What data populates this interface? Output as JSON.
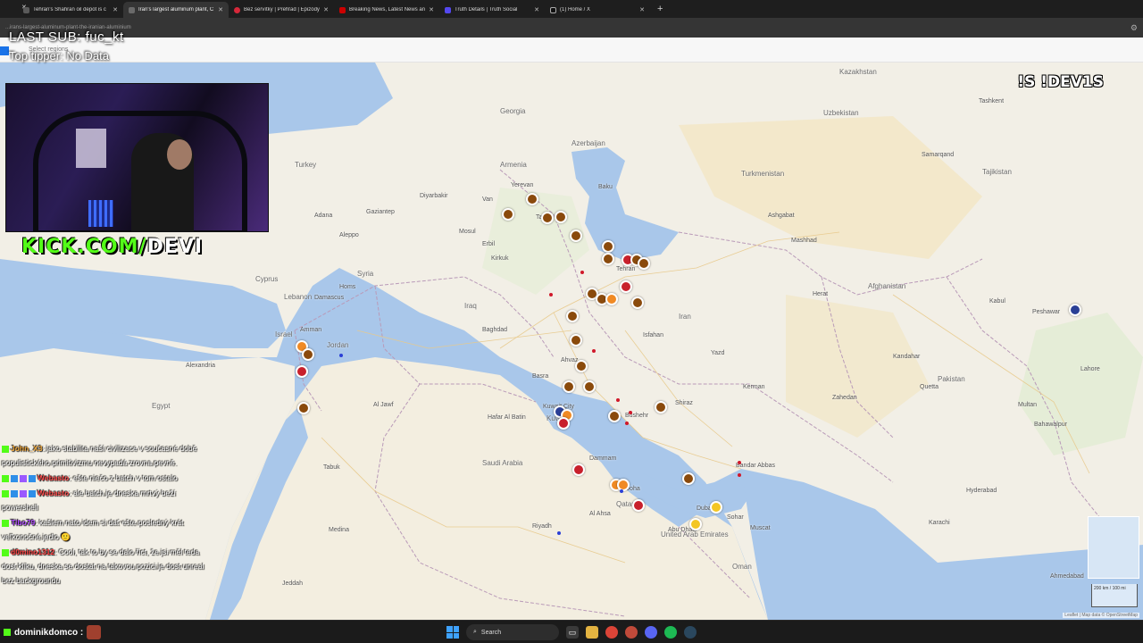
{
  "browser": {
    "tabs": [
      {
        "title": "Tehran's Shahran oil depot is c",
        "fav": "#5a5a5a",
        "active": false
      },
      {
        "title": "Iran's largest aluminum plant, C",
        "fav": "#6a6a6a",
        "active": true
      },
      {
        "title": "Bez servítky | Prehľad | Epizódy",
        "fav": "#d6283a",
        "active": false
      },
      {
        "title": "Breaking News, Latest News an",
        "fav": "#cc0000",
        "active": false
      },
      {
        "title": "Truth Details | Truth Social",
        "fav": "#5448ee",
        "active": false
      },
      {
        "title": "(1) Home / X",
        "fav": "#111111",
        "active": false
      }
    ],
    "new_tab": "+",
    "close": "✕",
    "url": "...irans-largest-aluminum-plant-the-iranian-aluminium",
    "settings_icon": "gear-icon"
  },
  "map_toolbar": {
    "select_regions": "Select regions"
  },
  "overlay": {
    "last_sub": "LAST SUB: fuc_kt",
    "top_tipper": "Top tipper: No Data",
    "kick_prefix": "KICK.COM/",
    "kick_suffix": "DEVI",
    "command": "!S !DEV1S"
  },
  "map": {
    "countries": [
      {
        "label": "Kazakhstan"
      },
      {
        "label": "Uzbekistan"
      },
      {
        "label": "Turkmenistan"
      },
      {
        "label": "Tajikistan"
      },
      {
        "label": "Afghanistan"
      },
      {
        "label": "Pakistan"
      },
      {
        "label": "Iran"
      },
      {
        "label": "Iraq"
      },
      {
        "label": "Syria"
      },
      {
        "label": "Jordan"
      },
      {
        "label": "Saudi Arabia"
      },
      {
        "label": "Egypt"
      },
      {
        "label": "Oman"
      },
      {
        "label": "United Arab Emirates"
      },
      {
        "label": "Kuwait"
      },
      {
        "label": "Qatar"
      },
      {
        "label": "Turkey"
      },
      {
        "label": "Azerbaijan"
      },
      {
        "label": "Georgia"
      },
      {
        "label": "Armenia"
      },
      {
        "label": "Cyprus"
      },
      {
        "label": "Lebanon"
      },
      {
        "label": "Israel"
      }
    ],
    "cities": [
      {
        "label": "Baghdad"
      },
      {
        "label": "Tehran"
      },
      {
        "label": "Riyadh"
      },
      {
        "label": "Kabul"
      },
      {
        "label": "Peshawar"
      },
      {
        "label": "Amman"
      },
      {
        "label": "Damascus"
      },
      {
        "label": "Homs"
      },
      {
        "label": "Aleppo"
      },
      {
        "label": "Mosul"
      },
      {
        "label": "Kirkuk"
      },
      {
        "label": "Basra"
      },
      {
        "label": "Kuwait City"
      },
      {
        "label": "Dammam"
      },
      {
        "label": "Doha"
      },
      {
        "label": "Dubai"
      },
      {
        "label": "Muscat"
      },
      {
        "label": "Bandar Abbas"
      },
      {
        "label": "Shiraz"
      },
      {
        "label": "Isfahan"
      },
      {
        "label": "Mashhad"
      },
      {
        "label": "Kandahar"
      },
      {
        "label": "Quetta"
      },
      {
        "label": "Herat"
      },
      {
        "label": "Samarqand"
      },
      {
        "label": "Tashkent"
      },
      {
        "label": "Ashgabat"
      },
      {
        "label": "Tabriz"
      },
      {
        "label": "Yerevan"
      },
      {
        "label": "Baku"
      },
      {
        "label": "Jeddah"
      },
      {
        "label": "Medina"
      },
      {
        "label": "Hyderabad"
      },
      {
        "label": "Karachi"
      },
      {
        "label": "Multan"
      },
      {
        "label": "Lahore"
      },
      {
        "label": "Ahmedabad"
      },
      {
        "label": "Bahawalpur"
      },
      {
        "label": "Zahedan"
      },
      {
        "label": "Kerman"
      },
      {
        "label": "Yazd"
      },
      {
        "label": "Al Ahsa"
      },
      {
        "label": "Hafar Al Batin"
      },
      {
        "label": "Al Jawf"
      },
      {
        "label": "Tabuk"
      },
      {
        "label": "Alexandria"
      },
      {
        "label": "Gaziantep"
      },
      {
        "label": "Adana"
      },
      {
        "label": "Diyarbakir"
      },
      {
        "label": "Van"
      },
      {
        "label": "Erbil"
      },
      {
        "label": "Ahvaz"
      },
      {
        "label": "Bushehr"
      },
      {
        "label": "Abu Dhabi"
      },
      {
        "label": "Sohar"
      }
    ],
    "attribution": "Leaflet | Map data © OpenStreetMap",
    "scale": "200 km / 100 mi"
  },
  "chat": [
    {
      "user": "John_X3",
      "color": "#f2a93b",
      "badges": 1,
      "text": ": jako stabilita naší civilizace v současné době populistického primitivizmu nevypadá zrovna pevně."
    },
    {
      "user": "Webasto",
      "color": "#ff4b4b",
      "badges": 4,
      "text": ": ešte niečo z batch v tom ostalo"
    },
    {
      "user": "Webasto",
      "color": "#ff4b4b",
      "badges": 4,
      "text": ": ale batch je dneska mrtvý beží powershell"
    },
    {
      "user": "Tibo79",
      "color": "#b04bff",
      "badges": 1,
      "text": ": kašlem nato idem si dať ešte posledný krát veľkonočné jedlo 🙂"
    },
    {
      "user": "d0mino1312",
      "color": "#ff4040",
      "badges": 1,
      "text": ": Cool, tak to by se dalo říct, že jsi měl teda dost klíku, dneska se dostat na takovou pozici je dost unreal bez backgroundu"
    }
  ],
  "taskbar": {
    "streamer": "dominikdomco :",
    "search": "Search"
  },
  "colors": {
    "kick_green": "#53fc18",
    "strike_brown": "#8a4a0c",
    "strike_red": "#c8202c",
    "strike_orange": "#f08a24",
    "strike_yellow": "#f3c623",
    "strike_blue": "#2a3f96",
    "sea": "#a9c7ea",
    "land": "#f2efe6"
  }
}
